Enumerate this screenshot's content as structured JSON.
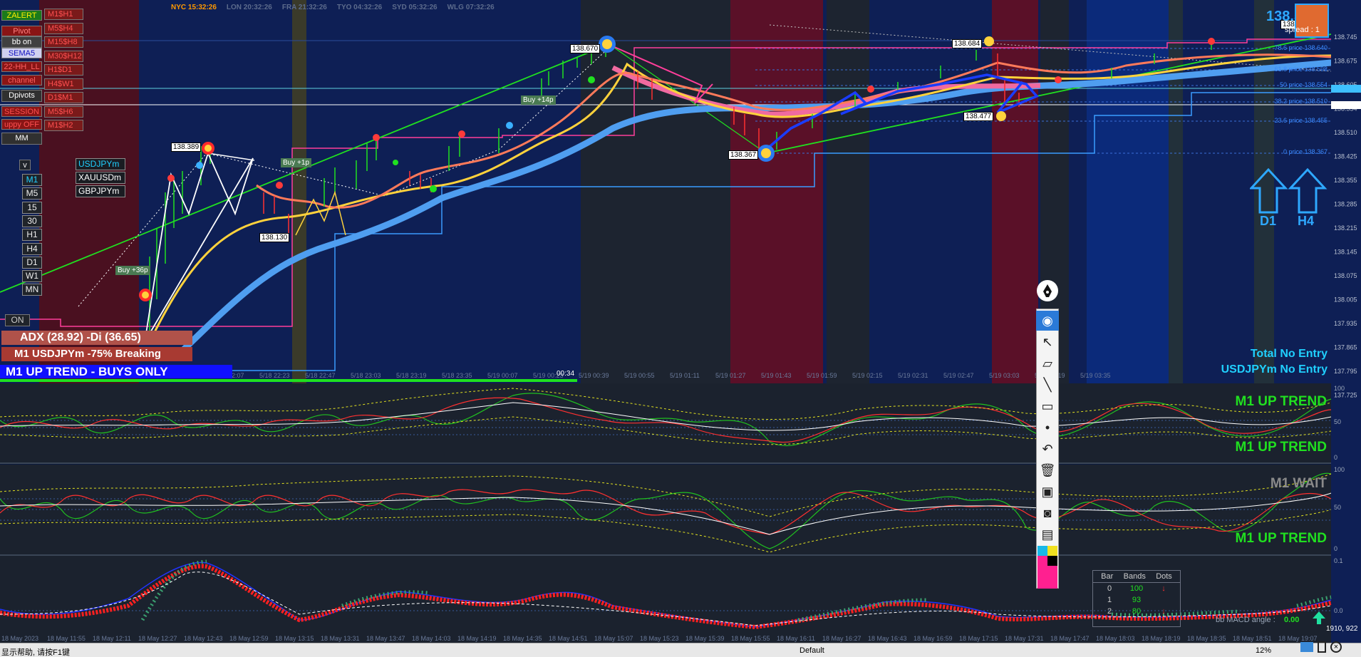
{
  "clocks": [
    {
      "label": "NYC 15:32:26",
      "color": "#ff9900"
    },
    {
      "label": "LON 20:32:26",
      "color": "#5c6b8c"
    },
    {
      "label": "FRA 21:32:26",
      "color": "#5c6b8c"
    },
    {
      "label": "TYO 04:32:26",
      "color": "#5c6b8c"
    },
    {
      "label": "SYD 05:32:26",
      "color": "#5c6b8c"
    },
    {
      "label": "WLG 07:32:26",
      "color": "#5c6b8c"
    }
  ],
  "left_panel": {
    "col1": [
      {
        "label": "ZALERT",
        "bg": "#1b7a1b",
        "fg": "#ffee00"
      },
      {
        "label": "Pivot",
        "bg": "#8a1515",
        "fg": "#ff8080"
      },
      {
        "label": "bb on",
        "bg": "#404040",
        "fg": "#ffffff"
      },
      {
        "label": "SEMA5",
        "bg": "#d0d0f0",
        "fg": "#1010c0"
      },
      {
        "label": "22-HH_LL",
        "bg": "#8a1515",
        "fg": "#ff6060"
      },
      {
        "label": "channel",
        "bg": "#8a1515",
        "fg": "#ff6060"
      },
      {
        "label": "Dpivots",
        "bg": "#303030",
        "fg": "#ffffff"
      },
      {
        "label": "SESSION",
        "bg": "#8a1515",
        "fg": "#ff5050"
      },
      {
        "label": "uppy OFF",
        "bg": "#8a1515",
        "fg": "#ff5050"
      },
      {
        "label": "MM",
        "bg": "#303030",
        "fg": "#ffffff"
      }
    ],
    "col2": [
      "M1$H1",
      "M5$H4",
      "M15$H8",
      "M30$H12",
      "H1$D1",
      "H4$W1",
      "D1$M1",
      "M5$H6",
      "M1$H2"
    ],
    "dropdown": "v",
    "timeframes": [
      "M1",
      "M5",
      "15",
      "30",
      "H1",
      "H4",
      "D1",
      "W1",
      "MN"
    ],
    "symbols": [
      "USDJPYm",
      "XAUUSDm",
      "GBPJPYm"
    ],
    "on_button": "ON"
  },
  "info": {
    "adx": "ADX (28.92)  -Di (36.65)",
    "breaking": "M1 USDJPYm -75% Breaking",
    "trend_banner": "M1 UP TREND - BUYS ONLY",
    "total_no_entry": "Total No Entry",
    "symbol_no_entry": "USDJPYm No Entry",
    "d1": "D1",
    "h4": "H4",
    "price_top": "138.5",
    "spread": "spread : 1",
    "countdown": "00:34"
  },
  "subwindow_labels": {
    "w1_top": "M1 UP TREND",
    "w1_bottom": "M1 UP TREND",
    "w2_top": "M1 WAIT",
    "w2_bottom": "M1 UP TREND"
  },
  "price_labels": [
    {
      "text": "138.670"
    },
    {
      "text": "138.389"
    },
    {
      "text": "138.130"
    },
    {
      "text": "138.684"
    },
    {
      "text": "138.477"
    },
    {
      "text": "138.367"
    }
  ],
  "buy_labels": [
    "Buy +14p",
    "Buy +1p",
    "Buy +36p"
  ],
  "fib_labels": [
    "78.6 price 138.640",
    "61.8 price 138.598",
    "50 price 138.554",
    "38.2 price 138.510",
    "23.6 price 138.455",
    "0 price 138.367"
  ],
  "price_axis": [
    "138.745",
    "138.675",
    "138.605",
    "138.554",
    "138.510",
    "138.425",
    "138.355",
    "138.285",
    "138.215",
    "138.145",
    "138.075",
    "138.005",
    "137.935",
    "137.865",
    "137.795",
    "137.725"
  ],
  "time_axis": [
    "5/18 22:07",
    "5/18 22:23",
    "5/18 22:47",
    "5/18 23:03",
    "5/18 23:19",
    "5/18 23:35",
    "5/19 00:07",
    "5/19 00:23",
    "5/19 00:39",
    "5/19 00:55",
    "5/19 01:11",
    "5/19 01:27",
    "5/19 01:43",
    "5/19 01:59",
    "5/19 02:15",
    "5/19 02:31",
    "5/19 02:47",
    "5/19 03:03",
    "5/19 03:19",
    "5/19 03:35"
  ],
  "bottom_axis": [
    "18 May 2023",
    "18 May 11:55",
    "18 May 12:11",
    "18 May 12:27",
    "18 May 12:43",
    "18 May 12:59",
    "18 May 13:15",
    "18 May 13:31",
    "18 May 13:47",
    "18 May 14:03",
    "18 May 14:19",
    "18 May 14:35",
    "18 May 14:51",
    "18 May 15:07",
    "18 May 15:23",
    "18 May 15:39",
    "18 May 15:55",
    "18 May 16:11",
    "18 May 16:27",
    "18 May 16:43",
    "18 May 16:59",
    "18 May 17:15",
    "18 May 17:31",
    "18 May 17:47",
    "18 May 18:03",
    "18 May 18:19",
    "18 May 18:35",
    "18 May 18:51",
    "18 May 19:07"
  ],
  "bands_table": {
    "headers": [
      "Bar",
      "Bands",
      "Dots"
    ],
    "rows": [
      [
        "0",
        "100",
        ""
      ],
      [
        "1",
        "93",
        ""
      ],
      [
        "2",
        "80",
        ""
      ]
    ]
  },
  "bb_macd": {
    "label": "bb MACD angle :",
    "value": "0.00"
  },
  "coords": "1910, 922",
  "statusbar": {
    "left": "显示帮助, 请按F1键",
    "profile": "Default",
    "pct": "12%"
  },
  "toolbar_icons": [
    "pen-icon",
    "eye-icon",
    "cursor-icon",
    "eraser-icon",
    "line-icon",
    "ruler-icon",
    "dot-icon",
    "undo-icon",
    "trash-icon",
    "screen-icon",
    "camera-icon",
    "clipboard-icon",
    "color-palette-icon"
  ]
}
